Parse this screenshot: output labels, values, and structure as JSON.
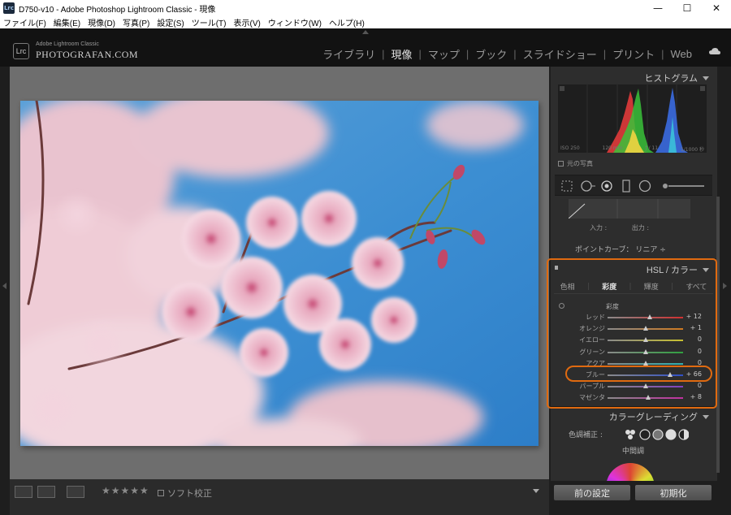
{
  "window": {
    "app_icon": "Lrc",
    "title": "D750-v10 - Adobe Photoshop Lightroom Classic - 現像",
    "controls": {
      "minimize": "—",
      "maximize": "☐",
      "close": "✕"
    }
  },
  "menu": [
    "ファイル(F)",
    "編集(E)",
    "現像(D)",
    "写真(P)",
    "設定(S)",
    "ツール(T)",
    "表示(V)",
    "ウィンドウ(W)",
    "ヘルプ(H)"
  ],
  "identity": {
    "logo_box": "Lrc",
    "subtitle": "Adobe Lightroom Classic",
    "name": "PHOTOGRAFAN.COM"
  },
  "modules": [
    {
      "label": "ライブラリ",
      "active": false
    },
    {
      "label": "現像",
      "active": true
    },
    {
      "label": "マップ",
      "active": false
    },
    {
      "label": "ブック",
      "active": false
    },
    {
      "label": "スライドショー",
      "active": false
    },
    {
      "label": "プリント",
      "active": false
    },
    {
      "label": "Web",
      "active": false
    }
  ],
  "toolbar": {
    "stars": "★★★★★",
    "soft_proof": "ソフト校正"
  },
  "histogram": {
    "title": "ヒストグラム",
    "iso": "ISO 250",
    "focal": "120 mm",
    "aperture": "ƒ / 11",
    "shutter": "1/1000 秒",
    "original_photo": "元の写真"
  },
  "tone_curve": {
    "input_label": "入力 :",
    "output_label": "出力 :",
    "point_curve_label": "ポイントカーブ：",
    "point_curve_value": "リニア ÷"
  },
  "hsl": {
    "title": "HSL / カラー",
    "tabs": [
      {
        "label": "色相",
        "active": false
      },
      {
        "label": "彩度",
        "active": true
      },
      {
        "label": "輝度",
        "active": false
      },
      {
        "label": "すべて",
        "active": false
      }
    ],
    "section_label": "彩度",
    "sliders": [
      {
        "label": "レッド",
        "value_text": "+ 12",
        "value": 12,
        "color": "#d03030"
      },
      {
        "label": "オレンジ",
        "value_text": "+ 1",
        "value": 1,
        "color": "#d07a20"
      },
      {
        "label": "イエロー",
        "value_text": "0",
        "value": 0,
        "color": "#c8c030"
      },
      {
        "label": "グリーン",
        "value_text": "0",
        "value": 0,
        "color": "#30a040"
      },
      {
        "label": "アクア",
        "value_text": "0",
        "value": 0,
        "color": "#30b0b0"
      },
      {
        "label": "ブルー",
        "value_text": "+ 66",
        "value": 66,
        "color": "#3050c8"
      },
      {
        "label": "パープル",
        "value_text": "0",
        "value": 0,
        "color": "#8040c0"
      },
      {
        "label": "マゼンタ",
        "value_text": "+ 8",
        "value": 8,
        "color": "#c030a0"
      }
    ]
  },
  "color_grading": {
    "title": "カラーグレーディング",
    "mode_label": "色調補正 :",
    "mid_label": "中間調"
  },
  "buttons": {
    "previous": "前の設定",
    "reset": "初期化"
  },
  "colors": {
    "highlight": "#e06a10",
    "panel_bg": "#2d2d2d",
    "view_bg": "#6e6e6e"
  }
}
